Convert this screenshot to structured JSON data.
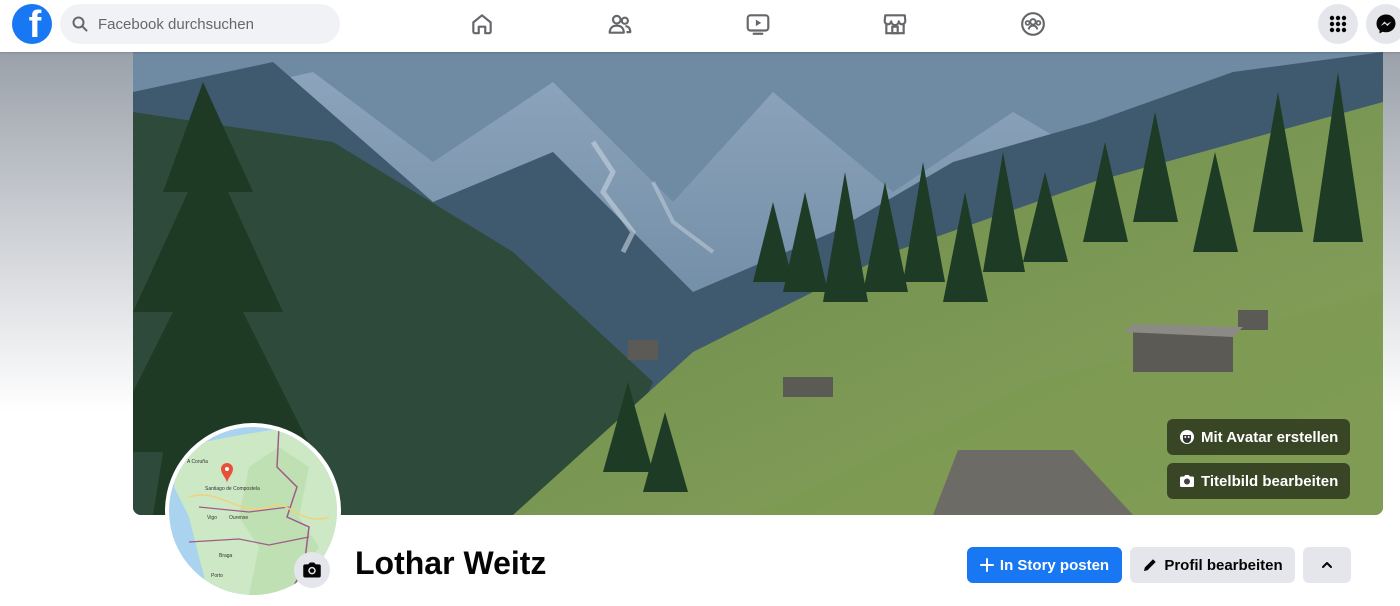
{
  "header": {
    "logo_icon": "facebook-logo-icon",
    "search": {
      "placeholder": "Facebook durchsuchen",
      "value": ""
    },
    "nav": [
      {
        "name": "home",
        "icon": "home-icon"
      },
      {
        "name": "friends",
        "icon": "friends-icon"
      },
      {
        "name": "watch",
        "icon": "video-icon"
      },
      {
        "name": "marketplace",
        "icon": "store-icon"
      },
      {
        "name": "groups",
        "icon": "groups-icon"
      }
    ],
    "right": [
      {
        "name": "menu",
        "icon": "grid-menu-icon"
      },
      {
        "name": "messenger",
        "icon": "messenger-icon"
      }
    ]
  },
  "cover": {
    "avatar_button_label": "Mit Avatar erstellen",
    "edit_cover_label": "Titelbild bearbeiten"
  },
  "profile": {
    "name": "Lothar Weitz",
    "map_labels": [
      "A Coruña",
      "Santiago de Compostela",
      "Vigo",
      "Ourense",
      "Braga",
      "Porto"
    ]
  },
  "actions": {
    "story_label": "In Story posten",
    "edit_profile_label": "Profil bearbeiten"
  },
  "colors": {
    "brand": "#1877f2",
    "button_secondary": "#e4e6eb",
    "text": "#050505"
  }
}
